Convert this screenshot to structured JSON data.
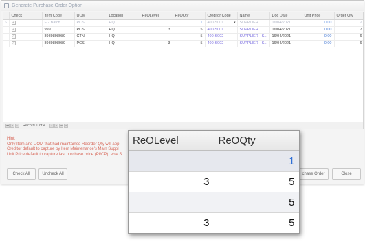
{
  "window": {
    "title": "Generate Purchase Order Option"
  },
  "grid": {
    "columns": [
      "Check",
      "Item Code",
      "UOM",
      "Location",
      "ReOLevel",
      "ReOQty",
      "Creditor Code",
      "Name",
      "Doc Date",
      "Unit Price",
      "Order Qty"
    ],
    "rows": [
      {
        "item_code": "FG Batch",
        "uom": "PCS",
        "location": "HQ",
        "reolevel": "",
        "reoqty": "1",
        "creditor_code": "400-S001",
        "name": "SUPPLIER",
        "doc_date": "16/04/2021",
        "unit_price": "0.00",
        "order_qty": "2"
      },
      {
        "item_code": "999",
        "uom": "PCS",
        "location": "HQ",
        "reolevel": "3",
        "reoqty": "5",
        "creditor_code": "400-S001",
        "name": "SUPPLIER",
        "doc_date": "16/04/2021",
        "unit_price": "0.00",
        "order_qty": "7"
      },
      {
        "item_code": "8989898989",
        "uom": "CTN",
        "location": "HQ",
        "reolevel": "",
        "reoqty": "5",
        "creditor_code": "400-S002",
        "name": "SUPPLIER - S...",
        "doc_date": "16/04/2021",
        "unit_price": "0.00",
        "order_qty": "6"
      },
      {
        "item_code": "8989898989",
        "uom": "PCS",
        "location": "HQ",
        "reolevel": "3",
        "reoqty": "5",
        "creditor_code": "400-S002",
        "name": "SUPPLIER - S...",
        "doc_date": "16/04/2021",
        "unit_price": "0.00",
        "order_qty": "6"
      }
    ]
  },
  "navigator": {
    "record": "Record 1 of 4"
  },
  "hint": {
    "title": "Hint:",
    "lines": [
      "Only Item and UOM that had maintained Reorder Qty will app",
      "Creditor default to capture by Item Maintenance's Main Suppl",
      "Unit Price default to capture last purchase price (PI/CP), else S"
    ]
  },
  "buttons": {
    "check_all": "Check All",
    "uncheck_all": "Uncheck All",
    "purchase_order": "chase Order",
    "close": "Close"
  },
  "zoom": {
    "columns": [
      "ReOLevel",
      "ReOQty"
    ],
    "rows": [
      {
        "reolevel": "",
        "reoqty": "1"
      },
      {
        "reolevel": "3",
        "reoqty": "5"
      },
      {
        "reolevel": "",
        "reoqty": "5"
      },
      {
        "reolevel": "3",
        "reoqty": "5"
      }
    ]
  }
}
